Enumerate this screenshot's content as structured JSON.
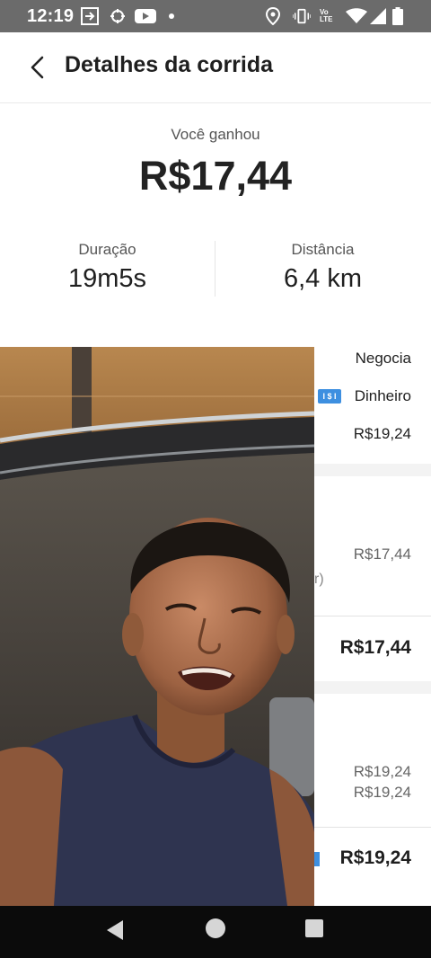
{
  "status_bar": {
    "time": "12:19",
    "icons": [
      "forward-icon",
      "game-controller-icon",
      "youtube-icon",
      "dot-icon",
      "location-icon",
      "vibrate-icon",
      "volte-icon",
      "wifi-icon",
      "cellular-signal-icon",
      "battery-icon"
    ],
    "volte_label": "Vo LTE"
  },
  "header": {
    "back_icon": "back-arrow-icon",
    "title": "Detalhes da corrida"
  },
  "summary": {
    "earned_label": "Você ganhou",
    "earned_amount": "R$17,44",
    "duration_label": "Duração",
    "duration_value": "19m5s",
    "distance_label": "Distância",
    "distance_value": "6,4 km"
  },
  "details": {
    "ride_type": "Negocia",
    "payment_method": "Dinheiro",
    "payment_icon_text": "I $ I",
    "fare": "R$19,24",
    "earnings_line": "R$17,44",
    "paren_fragment": "r)",
    "earnings_total": "R$17,44",
    "charged_line_1": "R$19,24",
    "charged_line_2": "R$19,24",
    "charged_total": "R$19,24"
  },
  "video_overlay": {
    "description_icon": "camera-video-overlay"
  },
  "nav_bar": {
    "back_icon": "nav-back-icon",
    "home_icon": "nav-home-icon",
    "recents_icon": "nav-recents-icon"
  }
}
